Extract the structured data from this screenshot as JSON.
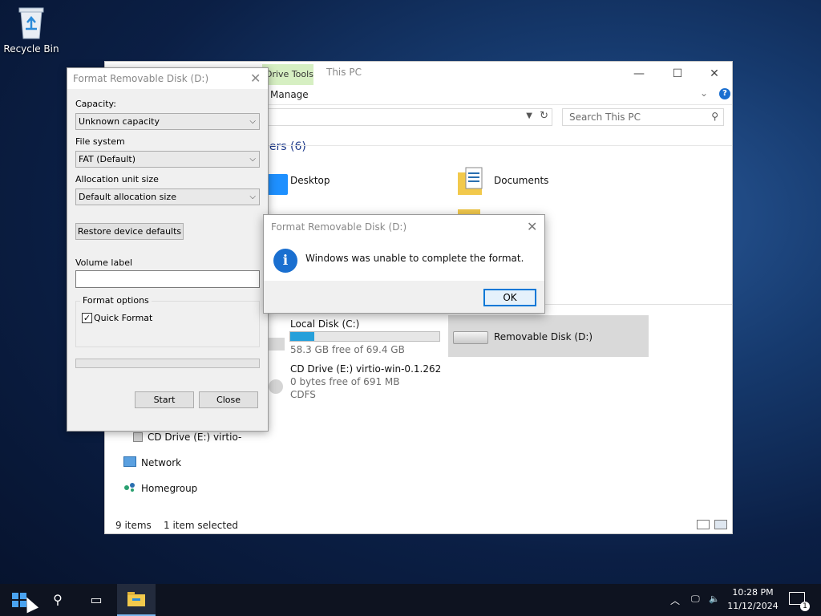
{
  "desktop": {
    "recycle_bin_label": "Recycle Bin"
  },
  "explorer": {
    "context_tab": "Drive Tools",
    "title": "This PC",
    "ribbon_tab": "Manage",
    "search_placeholder": "Search This PC",
    "section_folders": "ders (6)",
    "folders": [
      {
        "label": "Desktop",
        "icon": "desktop-folder-icon"
      },
      {
        "label": "Documents",
        "icon": "documents-folder-icon"
      }
    ],
    "drives": {
      "local_c": {
        "label": "Local Disk (C:)",
        "free": "58.3 GB free of 69.4 GB",
        "used_fraction": 0.16
      },
      "cd_e": {
        "label": "CD Drive (E:) virtio-win-0.1.262",
        "free": "0 bytes free of 691 MB",
        "fs": "CDFS"
      },
      "removable_d": {
        "label": "Removable Disk (D:)"
      }
    },
    "nav": {
      "cd_drive": "CD Drive (E:) virtio-",
      "network": "Network",
      "homegroup": "Homegroup"
    },
    "status": {
      "items": "9 items",
      "selected": "1 item selected"
    }
  },
  "format_dialog": {
    "title": "Format Removable Disk (D:)",
    "capacity_label": "Capacity:",
    "capacity_value": "Unknown capacity",
    "fs_label": "File system",
    "fs_value": "FAT (Default)",
    "alloc_label": "Allocation unit size",
    "alloc_value": "Default allocation size",
    "restore_button": "Restore device defaults",
    "volume_label": "Volume label",
    "volume_value": "",
    "options_group": "Format options",
    "quick_format_label": "Quick Format",
    "quick_format_checked": true,
    "start_button": "Start",
    "close_button": "Close"
  },
  "message_box": {
    "title": "Format Removable Disk (D:)",
    "message": "Windows was unable to complete the format.",
    "ok_button": "OK",
    "icon": "info-icon"
  },
  "taskbar": {
    "time": "10:28 PM",
    "date": "11/12/2024",
    "notifications": "1"
  },
  "colors": {
    "accent": "#0078d7",
    "progress": "#26a0da",
    "context_tab": "#d6efc2"
  }
}
